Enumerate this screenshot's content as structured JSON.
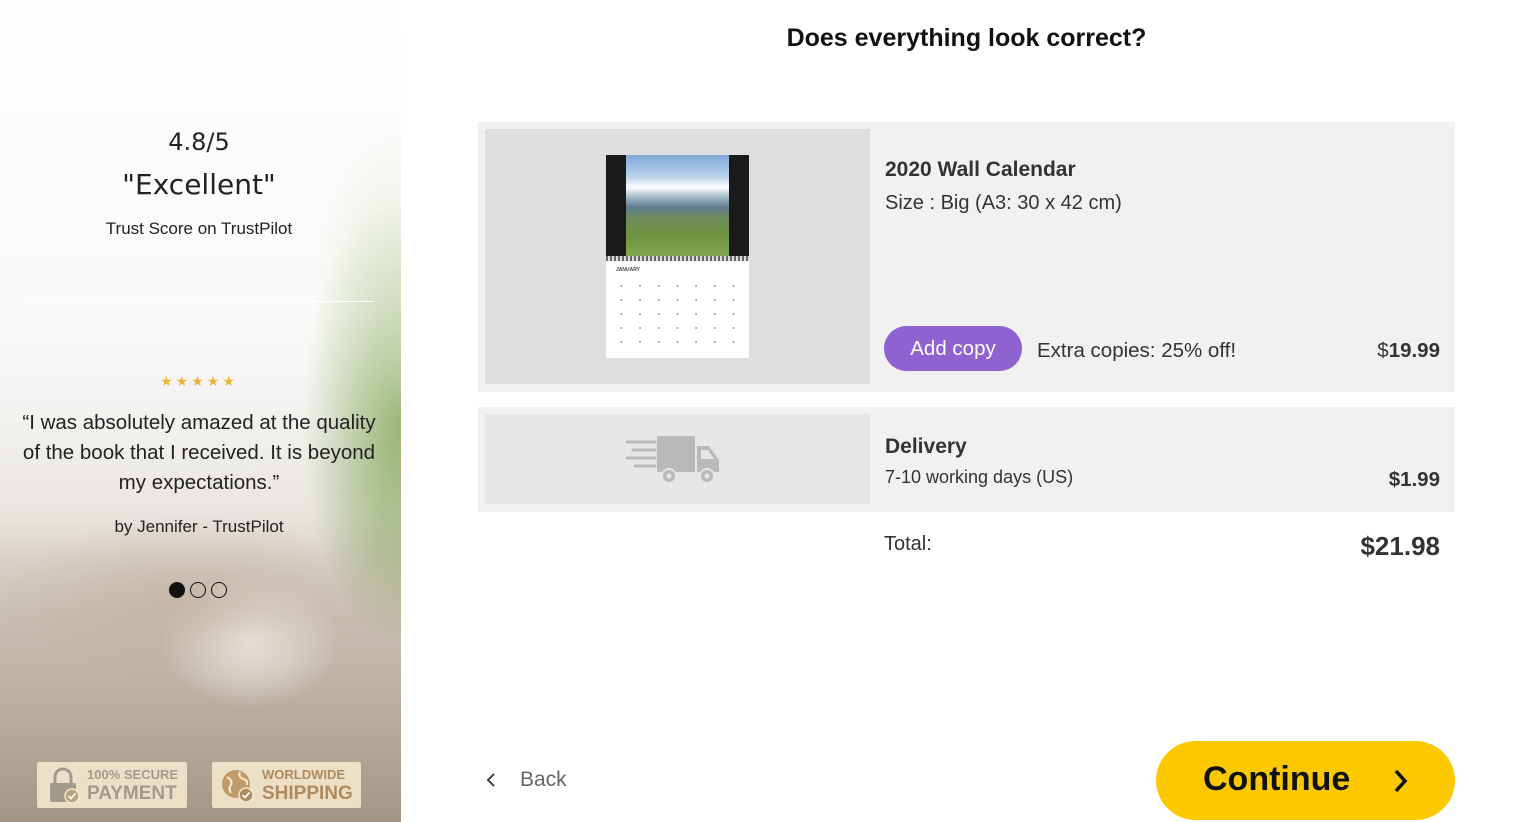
{
  "sidebar": {
    "rating": "4.8/5",
    "rating_label": "\"Excellent\"",
    "trust_text": "Trust Score on TrustPilot",
    "stars": "★★★★★",
    "review_quote": "“I was absolutely amazed at the quality of the book that I received. It is beyond my expectations.”",
    "review_author": "by Jennifer - TrustPilot",
    "carousel": {
      "total": 3,
      "active_index": 0
    },
    "badges": [
      {
        "line1": "100% SECURE",
        "line2": "PAYMENT",
        "icon": "lock-check-icon"
      },
      {
        "line1": "WORLDWIDE",
        "line2": "SHIPPING",
        "icon": "globe-check-icon"
      }
    ]
  },
  "main": {
    "title": "Does everything look correct?",
    "product": {
      "name": "2020 Wall Calendar",
      "size": "Size : Big (A3: 30 x 42 cm)",
      "calendar_month": "JANUARY",
      "add_copy_label": "Add copy",
      "extra_copies_text": "Extra copies: 25% off!",
      "price_currency": "$",
      "price_amount": "19.99"
    },
    "delivery": {
      "name": "Delivery",
      "detail": "7-10 working days (US)",
      "price": "$1.99",
      "icon": "delivery-truck-icon"
    },
    "total": {
      "label": "Total:",
      "value": "$21.98"
    },
    "back_label": "Back",
    "continue_label": "Continue"
  },
  "colors": {
    "accent_yellow": "#fcc900",
    "add_copy_purple": "#8f63cf",
    "star_gold": "#e8b43a",
    "card_bg": "#f1f1f1"
  }
}
